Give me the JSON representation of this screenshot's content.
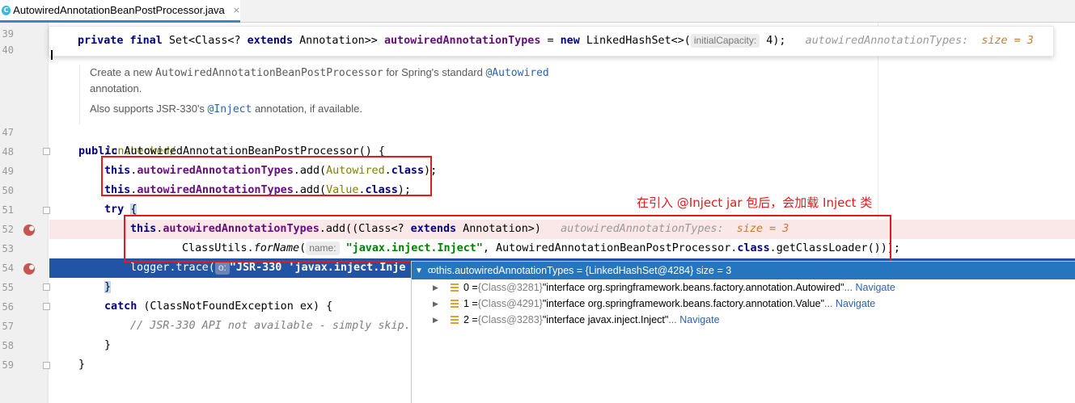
{
  "tab": {
    "icon": "java-class-icon",
    "filename": "AutowiredAnnotationBeanPostProcessor.java",
    "close": "×"
  },
  "gutter": {
    "lines": [
      "39",
      "40",
      "47",
      "48",
      "49",
      "50",
      "51",
      "52",
      "53",
      "54",
      "55",
      "56",
      "57",
      "58",
      "59"
    ]
  },
  "sticky": {
    "kw1": "private",
    "kw2": "final",
    "t1": " Set<Class<? ",
    "kw3": "extends",
    "t2": " Annotation>> ",
    "field": "autowiredAnnotationTypes",
    "t3": " = ",
    "kw4": "new",
    "t4": " LinkedHashSet<>(",
    "hint": "initialCapacity:",
    "t5": " 4);",
    "inline_name": "autowiredAnnotationTypes:",
    "inline_val": "size = 3"
  },
  "doc": {
    "p1a": "Create a new ",
    "p1code": "AutowiredAnnotationBeanPostProcessor",
    "p1b": " for Spring's standard ",
    "p1link": "@Autowired",
    "p1c": "annotation.",
    "p2a": "Also supports JSR-330's ",
    "p2link": "@Inject",
    "p2b": " annotation, if available."
  },
  "code": {
    "l47": "/unchecked/",
    "l48_kw": "public",
    "l48_rest": " AutowiredAnnotationBeanPostProcessor() {",
    "l49_kw": "this",
    "l49_dot": ".",
    "l49_field": "autowiredAnnotationTypes",
    "l49_a": ".add(",
    "l49_ann": "Autowired",
    "l49_dot2": ".",
    "l49_kw2": "class",
    "l49_b": ");",
    "l50_kw": "this",
    "l50_dot": ".",
    "l50_field": "autowiredAnnotationTypes",
    "l50_a": ".add(",
    "l50_ann": "Value",
    "l50_dot2": ".",
    "l50_kw2": "class",
    "l50_b": ");",
    "l51_kw": "try",
    "l51_b": "{",
    "l52_kw": "this",
    "l52_dot": ".",
    "l52_field": "autowiredAnnotationTypes",
    "l52_a": ".add((Class<? ",
    "l52_kw2": "extends",
    "l52_b": " Annotation>)",
    "l52_inline_name": "autowiredAnnotationTypes:",
    "l52_inline_val": "size = 3",
    "l53_a": "ClassUtils.",
    "l53_method": "forName",
    "l53_b": "(",
    "l53_hint": "name:",
    "l53_str": "\"javax.inject.Inject\"",
    "l53_c": ", AutowiredAnnotationBeanPostProcessor.",
    "l53_kw": "class",
    "l53_d": ".getClassLoader()));",
    "l54_a": "logger.trace(",
    "l54_hint": "o:",
    "l54_str": "\"JSR-330 'javax.inject.Inje",
    "l55": "}",
    "l56_kw": "catch",
    "l56_rest": " (ClassNotFoundException ex) {",
    "l57": "// JSR-330 API not available - simply skip.",
    "l58": "}",
    "l59": "}"
  },
  "note": "在引入 @Inject jar 包后，会加载 Inject 类",
  "debugger": {
    "header": "this.autowiredAnnotationTypes = {LinkedHashSet@4284}  size = 3",
    "items": [
      {
        "index": "0 = ",
        "ref": "{Class@3281}",
        "value": " \"interface org.springframework.beans.factory.annotation.Autowired\"",
        "nav": "... Navigate"
      },
      {
        "index": "1 = ",
        "ref": "{Class@4291}",
        "value": " \"interface org.springframework.beans.factory.annotation.Value\"",
        "nav": "... Navigate"
      },
      {
        "index": "2 = ",
        "ref": "{Class@3283}",
        "value": " \"interface javax.inject.Inject\"",
        "nav": "... Navigate"
      }
    ]
  },
  "colors": {
    "accent": "#2675bf",
    "breakpoint": "#c75450",
    "annotation_box": "#e21a1a"
  }
}
